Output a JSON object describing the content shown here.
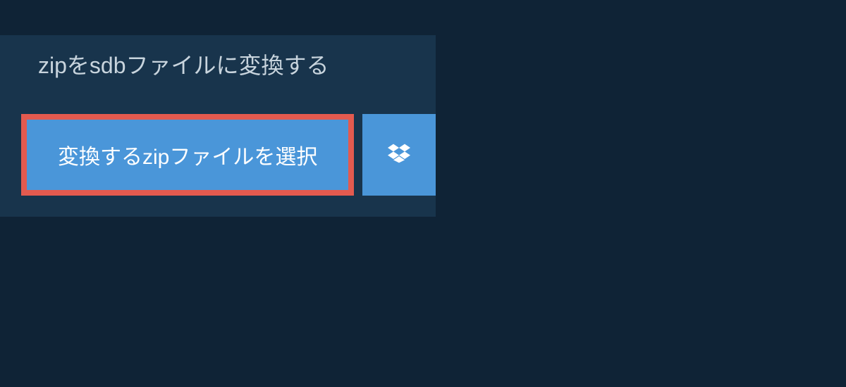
{
  "heading": "zipをsdbファイルに変換する",
  "buttons": {
    "select_label": "変換するzipファイルを選択"
  }
}
